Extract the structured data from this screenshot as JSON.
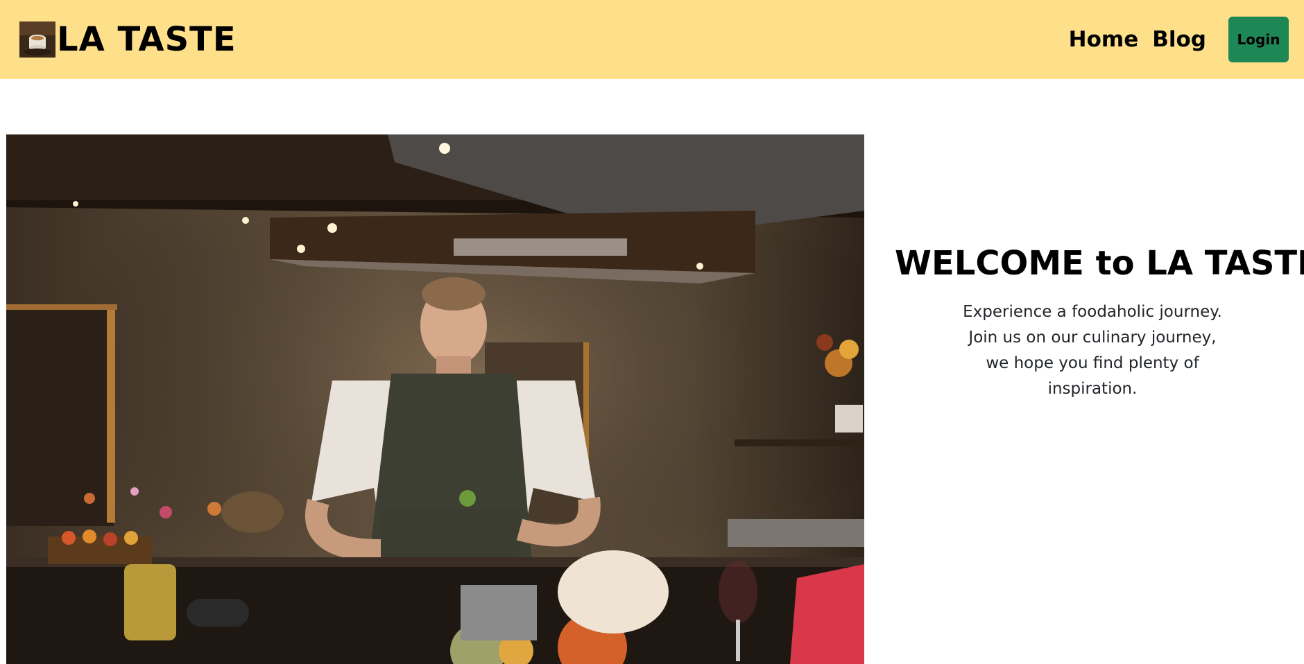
{
  "navbar": {
    "brand_name": "LA TASTE",
    "logo_icon": "coffee-cup-photo-icon",
    "links": [
      {
        "label": "Home"
      },
      {
        "label": "Blog"
      }
    ],
    "login_label": "Login",
    "background_color": "#ffe08a",
    "login_color": "#1e8756"
  },
  "hero": {
    "image_description_icon": "chef-kitchen-photo",
    "title": "WELCOME to LA TASTE",
    "text": "Experience a foodaholic journey. Join us on our culinary journey, we hope you find plenty of inspiration."
  }
}
